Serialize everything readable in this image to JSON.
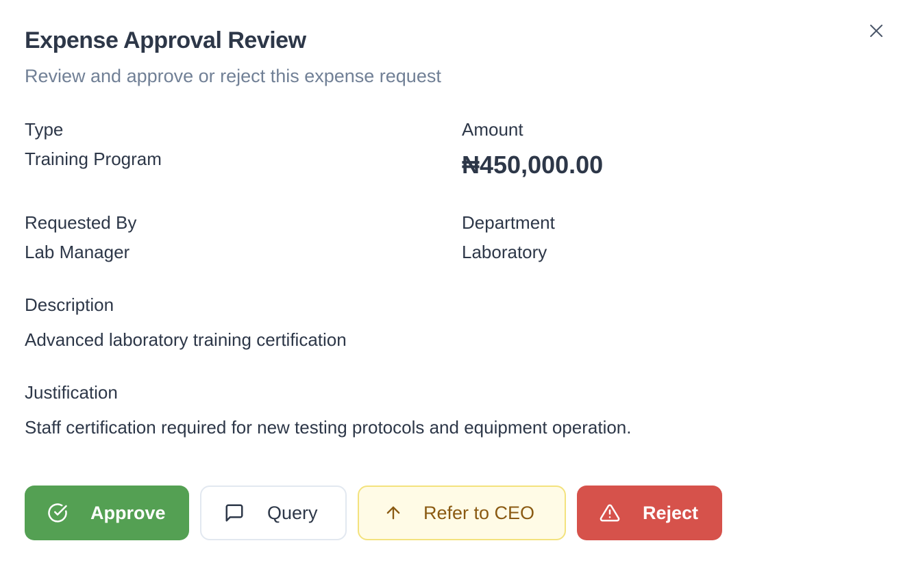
{
  "dialog": {
    "title": "Expense Approval Review",
    "subtitle": "Review and approve or reject this expense request"
  },
  "fields": {
    "type": {
      "label": "Type",
      "value": "Training Program"
    },
    "amount": {
      "label": "Amount",
      "value": "₦450,000.00"
    },
    "requested_by": {
      "label": "Requested By",
      "value": "Lab Manager"
    },
    "department": {
      "label": "Department",
      "value": "Laboratory"
    },
    "description": {
      "label": "Description",
      "value": "Advanced laboratory training certification"
    },
    "justification": {
      "label": "Justification",
      "value": "Staff certification required for new testing protocols and equipment operation."
    }
  },
  "actions": {
    "approve": {
      "label": "Approve",
      "icon": "check-circle-icon",
      "color": "#54a053"
    },
    "query": {
      "label": "Query",
      "icon": "message-square-icon",
      "color": "#ffffff"
    },
    "refer": {
      "label": "Refer to CEO",
      "icon": "arrow-up-icon",
      "color": "#fffbe6"
    },
    "reject": {
      "label": "Reject",
      "icon": "alert-triangle-icon",
      "color": "#d6524b"
    }
  },
  "close_icon": "close-icon"
}
